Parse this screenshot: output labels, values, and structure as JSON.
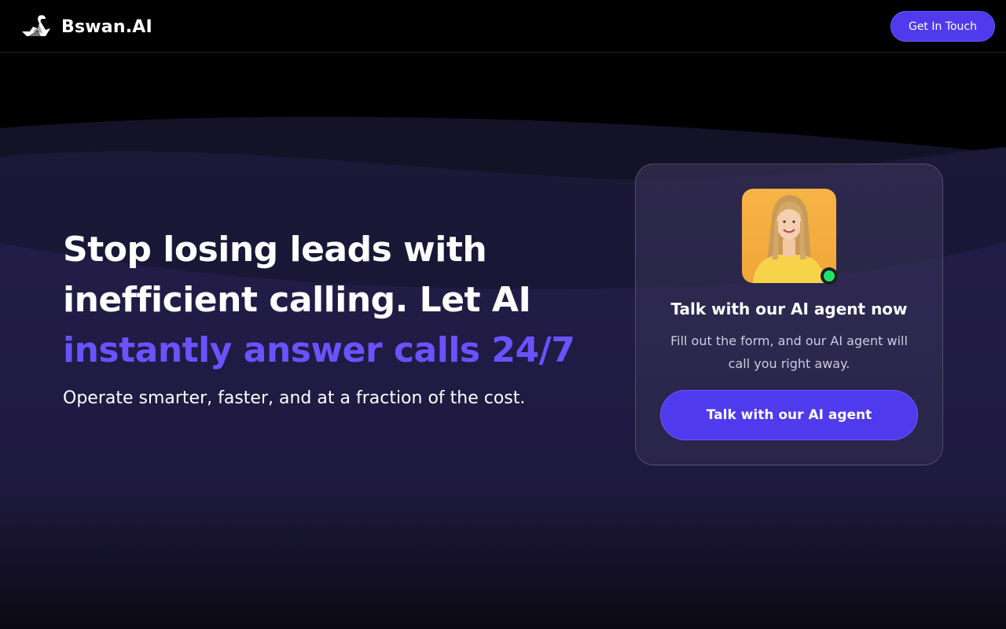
{
  "header": {
    "brand_name": "Bswan.AI",
    "logo_icon": "swan-logo-icon",
    "cta_label": "Get In Touch"
  },
  "hero": {
    "title_line1": "Stop losing leads with",
    "title_line2": "inefficient calling. Let AI",
    "title_accent": "instantly answer calls 24/7",
    "subtitle": "Operate smarter, faster, and at a fraction of the cost."
  },
  "card": {
    "title": "Talk with our AI agent now",
    "description": "Fill out the form, and our AI agent will call you right away.",
    "cta_label": "Talk with our AI agent",
    "avatar_icon": "agent-avatar",
    "status": "online"
  },
  "colors": {
    "accent": "#6b52ff",
    "button": "#4f3aee",
    "background": "#000000",
    "wave": "#1f1a3f",
    "status_online": "#1ee36b",
    "avatar_bg": "#f5b342"
  }
}
